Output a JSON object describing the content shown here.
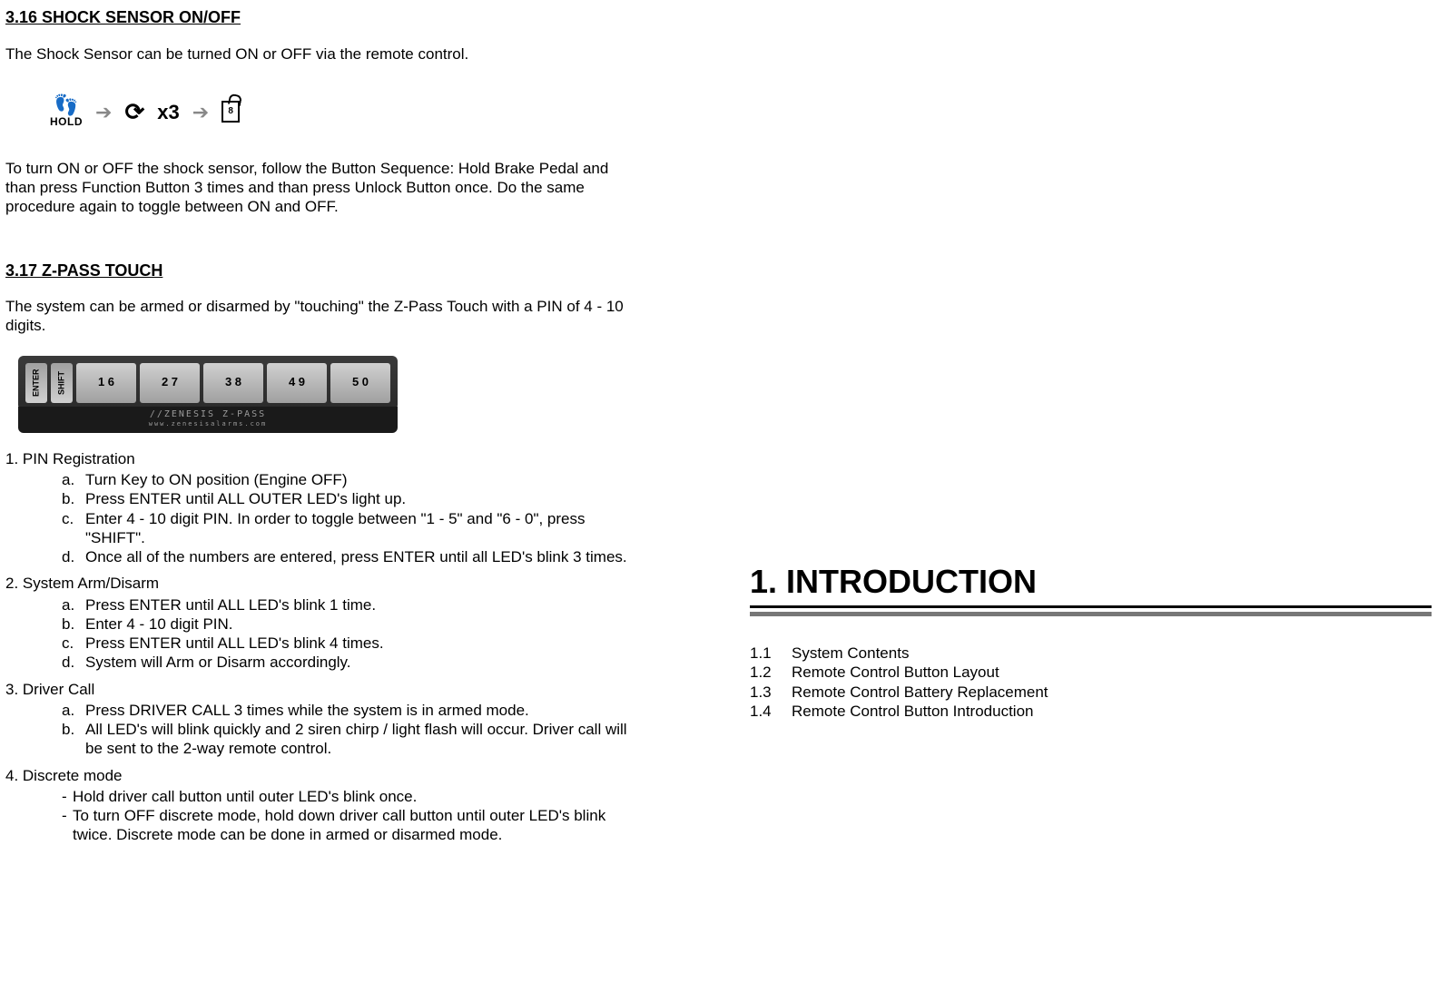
{
  "left": {
    "section316": {
      "heading": "3.16   SHOCK SENSOR ON/OFF",
      "intro": "The Shock Sensor can be turned ON or OFF via the remote control.",
      "seq": {
        "hold_label": "HOLD",
        "x3": "x3",
        "lock_inner": "8"
      },
      "para2": "To turn ON or OFF the shock sensor, follow the Button Sequence: Hold Brake Pedal and than press Function Button 3 times and than press Unlock Button once. Do the same procedure again to toggle between ON and OFF."
    },
    "section317": {
      "heading": "3.17  Z-PASS TOUCH",
      "intro": "The system can be armed or disarmed by \"touching\" the Z-Pass Touch with a PIN of 4 - 10 digits.",
      "keypad": {
        "enter": "ENTER",
        "shift": "SHIFT",
        "keys": [
          "1  6",
          "2  7",
          "3  8",
          "4  9",
          "5  0"
        ],
        "brand": "//ZENESIS  Z-PASS",
        "brand_sub": "www.zenesisalarms.com"
      },
      "group1_title": "1. PIN Registration",
      "group1": [
        {
          "m": "a.",
          "t": "Turn Key to ON position (Engine OFF)"
        },
        {
          "m": "b.",
          "t": "Press ENTER until ALL OUTER LED's light up."
        },
        {
          "m": "c.",
          "t": "Enter 4 - 10 digit PIN.  In order to toggle between \"1 - 5\" and \"6 - 0\", press \"SHIFT\"."
        },
        {
          "m": "d.",
          "t": "Once all of the numbers are entered, press ENTER until all LED's blink 3 times."
        }
      ],
      "group2_title": "2. System Arm/Disarm",
      "group2": [
        {
          "m": "a.",
          "t": "Press ENTER until ALL LED's blink 1 time."
        },
        {
          "m": "b.",
          "t": "Enter 4 - 10 digit PIN."
        },
        {
          "m": "c.",
          "t": "Press ENTER until ALL LED's blink 4 times."
        },
        {
          "m": "d.",
          "t": "System will Arm or Disarm accordingly."
        }
      ],
      "group3_title": "3. Driver Call",
      "group3": [
        {
          "m": "a.",
          "t": "Press DRIVER CALL 3 times while the system is in armed mode."
        },
        {
          "m": "b.",
          "t": "All LED's will blink quickly and 2 siren chirp / light flash will occur. Driver call will be sent to the 2-way remote control."
        }
      ],
      "group4_title": "4. Discrete mode",
      "group4": [
        "Hold driver call button until outer LED's blink once.",
        "To turn OFF discrete mode, hold down driver call button until outer LED's blink twice. Discrete mode can be done in armed or disarmed mode."
      ]
    }
  },
  "right": {
    "intro_heading": "1.  INTRODUCTION",
    "toc": [
      {
        "num": "1.1",
        "label": "System Contents"
      },
      {
        "num": "1.2",
        "label": "Remote Control Button Layout"
      },
      {
        "num": "1.3",
        "label": "Remote Control Battery Replacement"
      },
      {
        "num": "1.4",
        "label": "Remote Control Button Introduction"
      }
    ]
  }
}
